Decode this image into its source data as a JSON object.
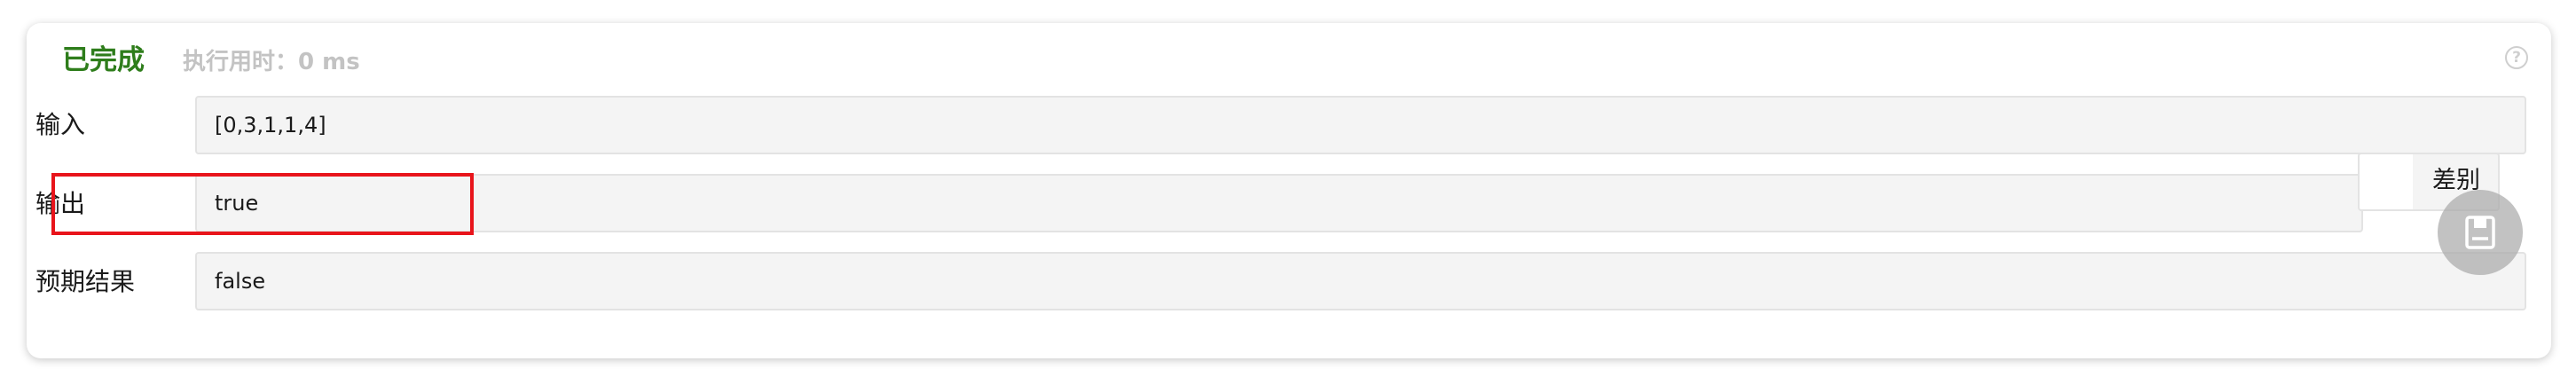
{
  "result": {
    "status": "已完成",
    "runtime": "执行用时：0 ms"
  },
  "rows": {
    "input": {
      "label": "输入",
      "value": "[0,3,1,1,4]"
    },
    "output": {
      "label": "输出",
      "value": "true"
    },
    "expected": {
      "label": "预期结果",
      "value": "false"
    }
  },
  "diff": {
    "label": "差别"
  },
  "icons": {
    "help": "help-circle-icon",
    "fab": "bookmark-icon"
  },
  "colors": {
    "status": "#2e7d1b",
    "highlight": "#e8141b"
  }
}
